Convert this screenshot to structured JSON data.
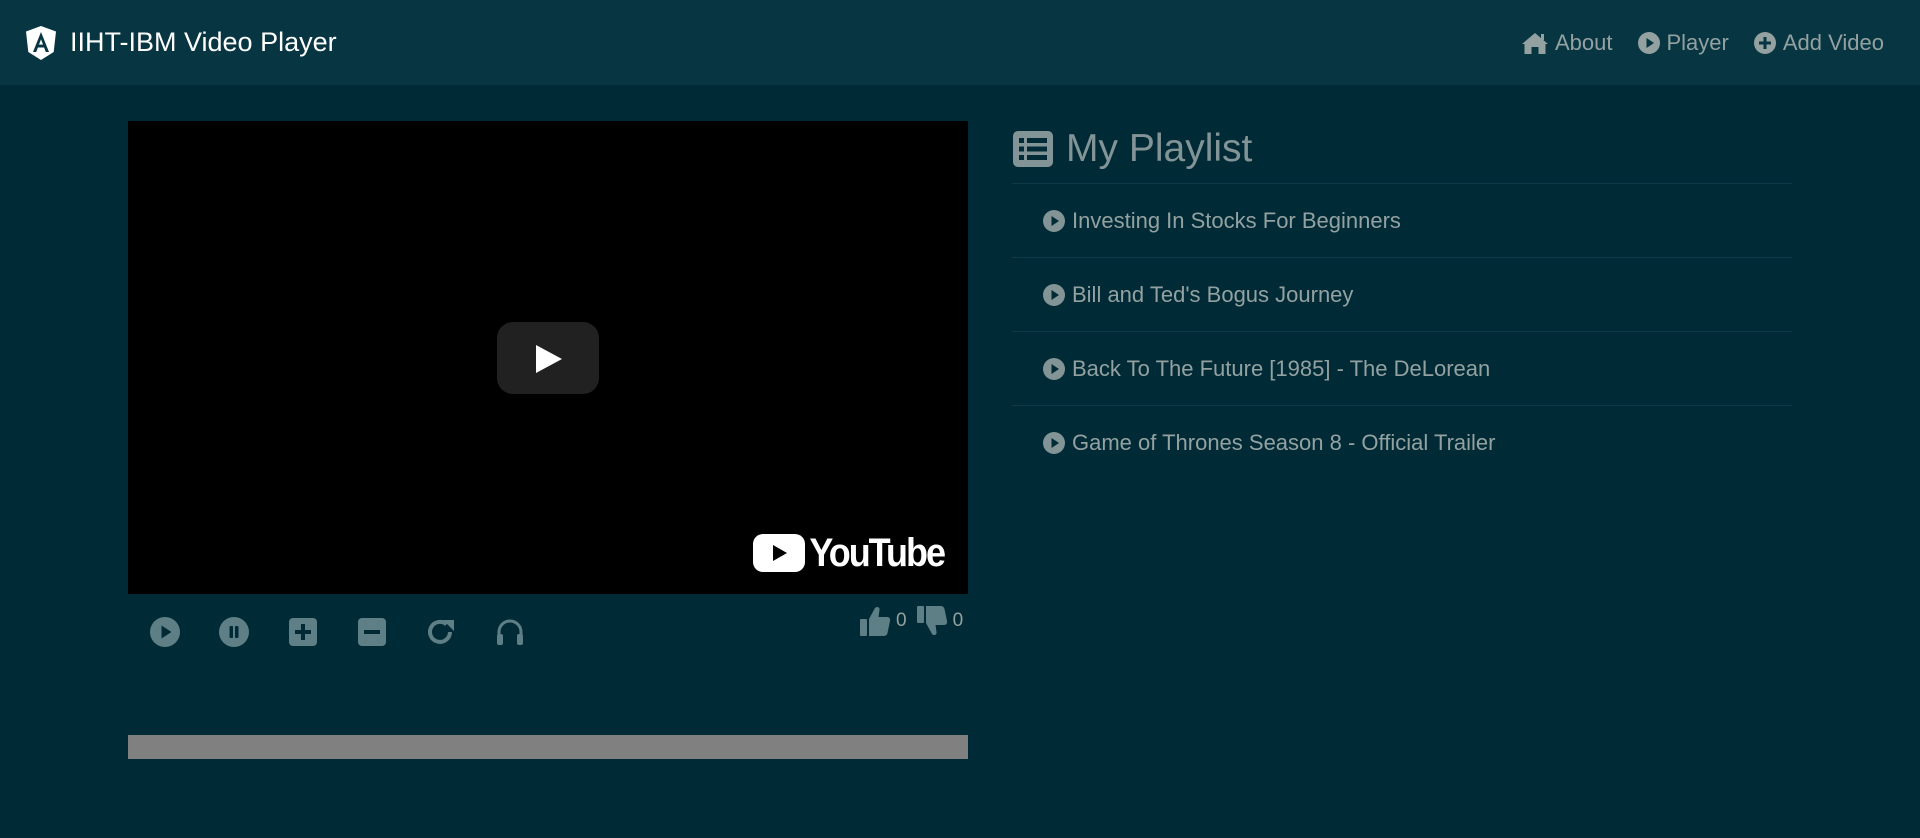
{
  "navbar": {
    "brand_title": "IIHT-IBM Video Player",
    "brand_icon": "angular-logo-icon",
    "links": [
      {
        "label": "About",
        "icon": "home-icon"
      },
      {
        "label": "Player",
        "icon": "play-circle-icon"
      },
      {
        "label": "Add Video",
        "icon": "plus-circle-icon"
      }
    ]
  },
  "player": {
    "overlay_brand": "YouTube",
    "controls": [
      {
        "name": "play",
        "icon": "play-circle-icon"
      },
      {
        "name": "pause",
        "icon": "pause-circle-icon"
      },
      {
        "name": "volume-up",
        "icon": "plus-square-icon"
      },
      {
        "name": "volume-down",
        "icon": "minus-square-icon"
      },
      {
        "name": "reload",
        "icon": "redo-icon"
      },
      {
        "name": "mute",
        "icon": "headphones-icon"
      }
    ],
    "likes": "0",
    "dislikes": "0"
  },
  "playlist": {
    "title": "My Playlist",
    "icon": "list-icon",
    "items": [
      {
        "title": "Investing In Stocks For Beginners"
      },
      {
        "title": "Bill and Ted's Bogus Journey"
      },
      {
        "title": "Back To The Future [1985] - The DeLorean"
      },
      {
        "title": "Game of Thrones Season 8 - Official Trailer"
      }
    ]
  },
  "colors": {
    "background": "#002b36",
    "navbar": "#073642",
    "text": "#839496",
    "icon": "#5f7f87",
    "progress": "#808080"
  }
}
